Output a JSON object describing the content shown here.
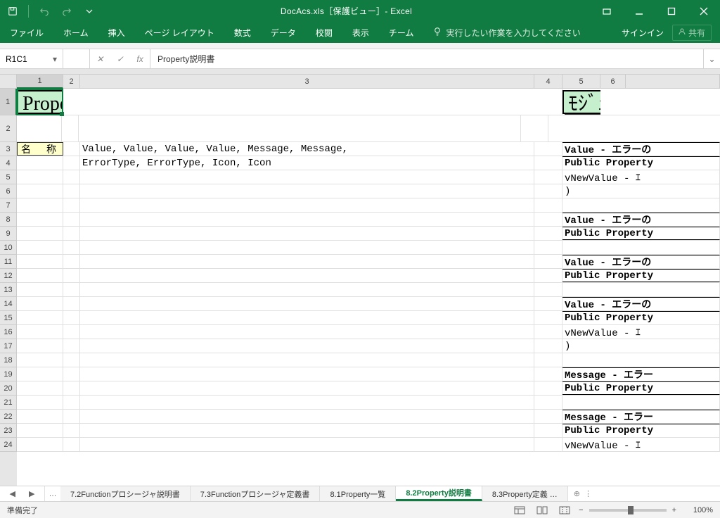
{
  "titlebar": {
    "title": "DocAcs.xls［保護ビュー］- Excel"
  },
  "ribbon": {
    "tabs": [
      "ファイル",
      "ホーム",
      "挿入",
      "ページ レイアウト",
      "数式",
      "データ",
      "校閲",
      "表示",
      "チーム"
    ],
    "tell_me": "実行したい作業を入力してください",
    "signin": "サインイン",
    "share": "共有"
  },
  "formula_bar": {
    "name_box": "R1C1",
    "formula": "Property説明書"
  },
  "sheet": {
    "col_labels": [
      "1",
      "2",
      "3",
      "4",
      "5",
      "6"
    ],
    "row_labels": [
      "1",
      "2",
      "3",
      "4",
      "5",
      "6",
      "7",
      "8",
      "9",
      "10",
      "11",
      "12",
      "13",
      "14",
      "15",
      "16",
      "17",
      "18",
      "19",
      "20",
      "21",
      "22",
      "23",
      "24"
    ],
    "title_left": "Property説明書",
    "title_right": "ﾓｼﾞｭｰﾙ_WCError",
    "name_label": "名　称",
    "row3_value": "Value, Value, Value, Value, Message, Message,",
    "row4_value": "ErrorType, ErrorType, Icon, Icon",
    "right_rows": {
      "r3": "Value - エラーの",
      "r4": "Public Property",
      "r5": "  vNewValue  - ｴ",
      "r6": ")",
      "r8": "Value - エラーの",
      "r9": "Public Property",
      "r11": "Value - エラーの",
      "r12": "Public Property",
      "r14": "Value - エラーの",
      "r15": "Public Property",
      "r16": "  vNewValue  - ｴ",
      "r17": ")",
      "r19": "Message - エラー",
      "r20": "Public Property",
      "r22": "Message - エラー",
      "r23": "Public Property",
      "r24": "  vNewValue  - ｴ"
    }
  },
  "sheet_tabs": {
    "tabs": [
      "7.2Functionプロシージャ説明書",
      "7.3Functionプロシージャ定義書",
      "8.1Property一覧",
      "8.2Property説明書",
      "8.3Property定義 …"
    ],
    "active_index": 3
  },
  "status": {
    "left": "準備完了",
    "zoom": "100%"
  },
  "colors": {
    "excel_green": "#107c41",
    "title_fill": "#c6efce",
    "label_fill": "#ffffcc"
  }
}
